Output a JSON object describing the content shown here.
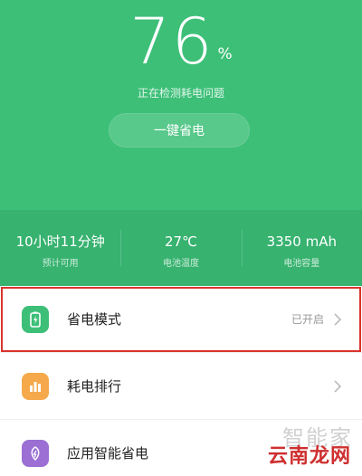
{
  "battery": {
    "percent_value": "76",
    "percent_sign": "%",
    "status": "正在检测耗电问题",
    "one_key_label": "一键省电"
  },
  "stats": [
    {
      "value": "10小时11分钟",
      "label": "预计可用"
    },
    {
      "value": "27℃",
      "label": "电池温度"
    },
    {
      "value": "3350 mAh",
      "label": "电池容量"
    }
  ],
  "list": [
    {
      "label": "省电模式",
      "status": "已开启",
      "icon": "battery-bolt-icon",
      "icon_color": "#3dbf78"
    },
    {
      "label": "耗电排行",
      "status": "",
      "icon": "bar-chart-icon",
      "icon_color": "#f5a94a"
    },
    {
      "label": "应用智能省电",
      "status": "",
      "icon": "leaf-icon",
      "icon_color": "#9b6fd3"
    }
  ],
  "watermark": {
    "top": "智能家",
    "main": "云南龙网"
  },
  "colors": {
    "hero_green": "#3dbf78",
    "highlight_red": "#d9342b"
  }
}
